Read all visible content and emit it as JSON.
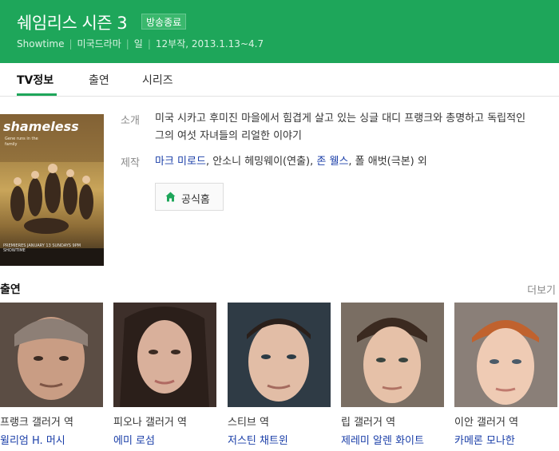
{
  "header": {
    "title": "쉐임리스 시즌 3",
    "status": "방송종료",
    "meta": [
      "Showtime",
      "미국드라마",
      "일",
      "12부작, 2013.1.13~4.7"
    ],
    "bg_color": "#1ea65a"
  },
  "tabs": [
    {
      "label": "TV정보",
      "active": true
    },
    {
      "label": "출연",
      "active": false
    },
    {
      "label": "시리즈",
      "active": false
    }
  ],
  "poster": {
    "logo": "shameless",
    "tagline": "Gene runs in the family",
    "footer": "PREMIERES JANUARY 13 SUNDAYS 9PM SHOWTIME"
  },
  "info": {
    "intro_label": "소개",
    "description": "미국 시카고 후미진 마을에서 힘겹게 살고 있는 싱글 대디 프랭크와 총명하고 독립적인 그의 여섯 자녀들의 리얼한 이야기",
    "credits_label": "제작",
    "credit_1": "마크 미로드",
    "credit_2": ", 안소니 헤밍웨이(연출), ",
    "credit_3": "존 웰스",
    "credit_4": ", 폴 애벗(극본) 외",
    "home_button": "공식홈"
  },
  "cast_section": {
    "heading": "출연",
    "more": "더보기",
    "members": [
      {
        "role": "프랭크 갤러거 역",
        "actor": "윌리엄 H. 머시"
      },
      {
        "role": "피오나 갤러거 역",
        "actor": "에미 로섬"
      },
      {
        "role": "스티브 역",
        "actor": "저스틴 채트윈"
      },
      {
        "role": "립 갤러거 역",
        "actor": "제레미 알렌 화이트"
      },
      {
        "role": "이안 갤러거 역",
        "actor": "카메론 모나한"
      }
    ]
  },
  "colors": {
    "accent": "#1ea65a",
    "link": "#1a3ea8"
  }
}
